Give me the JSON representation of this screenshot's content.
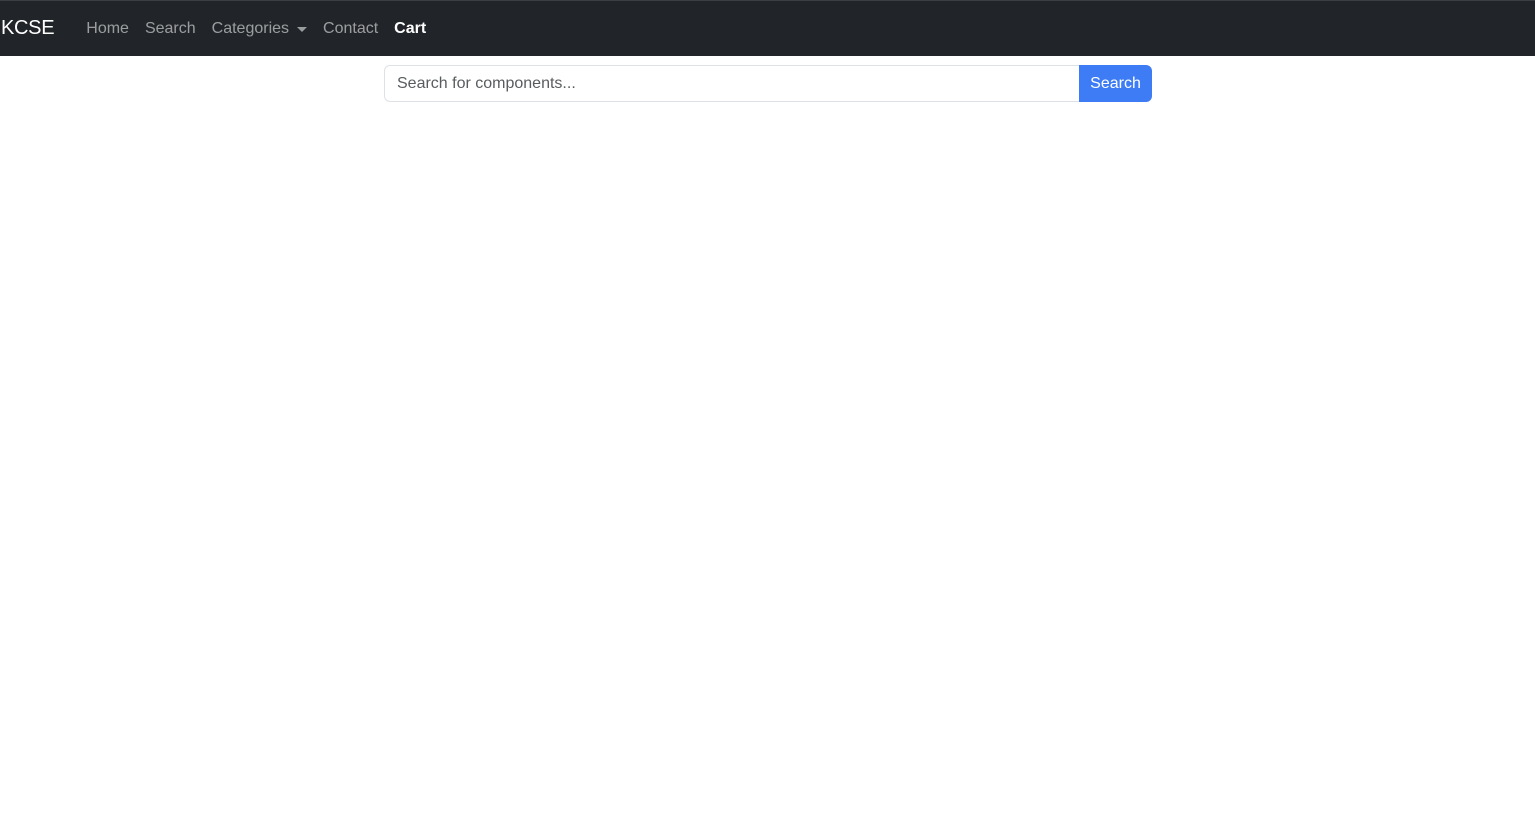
{
  "navbar": {
    "brand": "KCSE",
    "items": [
      {
        "label": "Home"
      },
      {
        "label": "Search"
      },
      {
        "label": "Categories"
      },
      {
        "label": "Contact"
      },
      {
        "label": "Cart"
      }
    ]
  },
  "search": {
    "placeholder": "Search for components...",
    "value": "",
    "button_label": "Search"
  },
  "colors": {
    "navbar_bg": "#212529",
    "primary": "#3d7cf5"
  }
}
